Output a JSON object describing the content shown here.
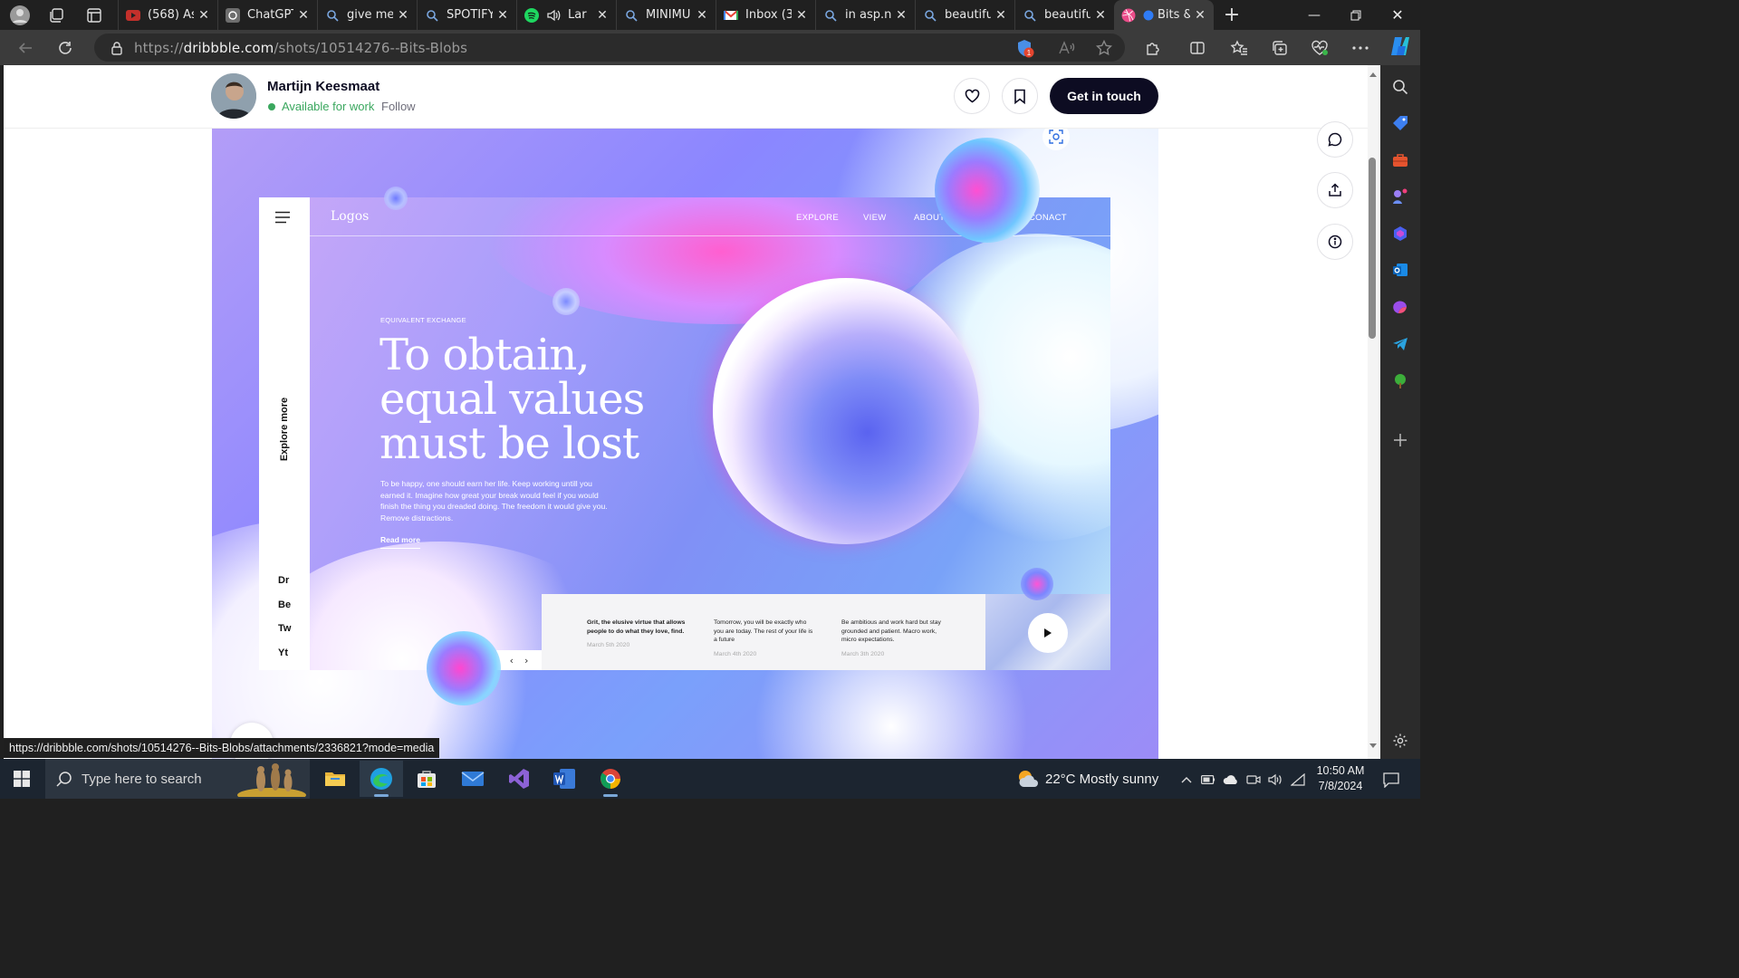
{
  "browser": {
    "tabs": [
      {
        "title": "(568) As",
        "icon": "youtube-icon"
      },
      {
        "title": "ChatGPT",
        "icon": "chatgpt-icon"
      },
      {
        "title": "give me",
        "icon": "search-icon"
      },
      {
        "title": "SPOTIFY",
        "icon": "search-icon"
      },
      {
        "title": "Lar",
        "icon": "spotify-icon"
      },
      {
        "title": "MINIMU",
        "icon": "search-icon"
      },
      {
        "title": "Inbox (3",
        "icon": "gmail-icon"
      },
      {
        "title": "in asp.n",
        "icon": "search-icon"
      },
      {
        "title": "beautifu",
        "icon": "search-icon"
      },
      {
        "title": "beautifu",
        "icon": "search-icon"
      },
      {
        "title": "Bits &",
        "icon": "dribbble-icon",
        "active": true
      }
    ],
    "url_prefix": "https://",
    "url_host": "dribbble.com",
    "url_path": "/shots/10514276--Bits-Blobs",
    "status_url": "https://dribbble.com/shots/10514276--Bits-Blobs/attachments/2336821?mode=media",
    "extension_badge": "1"
  },
  "shot_header": {
    "author": "Martijn Keesmaat",
    "availability": "Available for work",
    "follow": "Follow",
    "cta": "Get in touch"
  },
  "mockup": {
    "logo": "Logos",
    "nav": [
      "EXPLORE",
      "VIEW",
      "ABOUT",
      "CONACT"
    ],
    "eyebrow": "EQUIVALENT EXCHANGE",
    "headline": "To obtain, equal values must be lost",
    "paragraph": "To be happy, one should earn her life. Keep working untill you earned it. Imagine how great your break would feel if you would finish the thing you dreaded doing. The freedom it would give you. Remove distractions.",
    "read_more": "Read more",
    "side_label": "Explore more",
    "socials": [
      "Dr",
      "Be",
      "Tw",
      "Yt"
    ],
    "cards": [
      {
        "text": "Grit, the elusive virtue that allows people to do what they love, find.",
        "date": "March 5th 2020"
      },
      {
        "text": "Tomorrow, you will be exactly who you are today. The rest of your life is a future",
        "date": "March 4th 2020"
      },
      {
        "text": "Be ambitious and work hard but stay grounded and patient. Macro work, micro expectations.",
        "date": "March 3th 2020"
      }
    ]
  },
  "taskbar": {
    "search_placeholder": "Type here to search",
    "weather": "22°C  Mostly sunny",
    "time": "10:50 AM",
    "date": "7/8/2024"
  },
  "colors": {
    "dribbble_dark": "#0d0c22",
    "available_green": "#3aa75e",
    "taskbar": "#1c2530"
  }
}
